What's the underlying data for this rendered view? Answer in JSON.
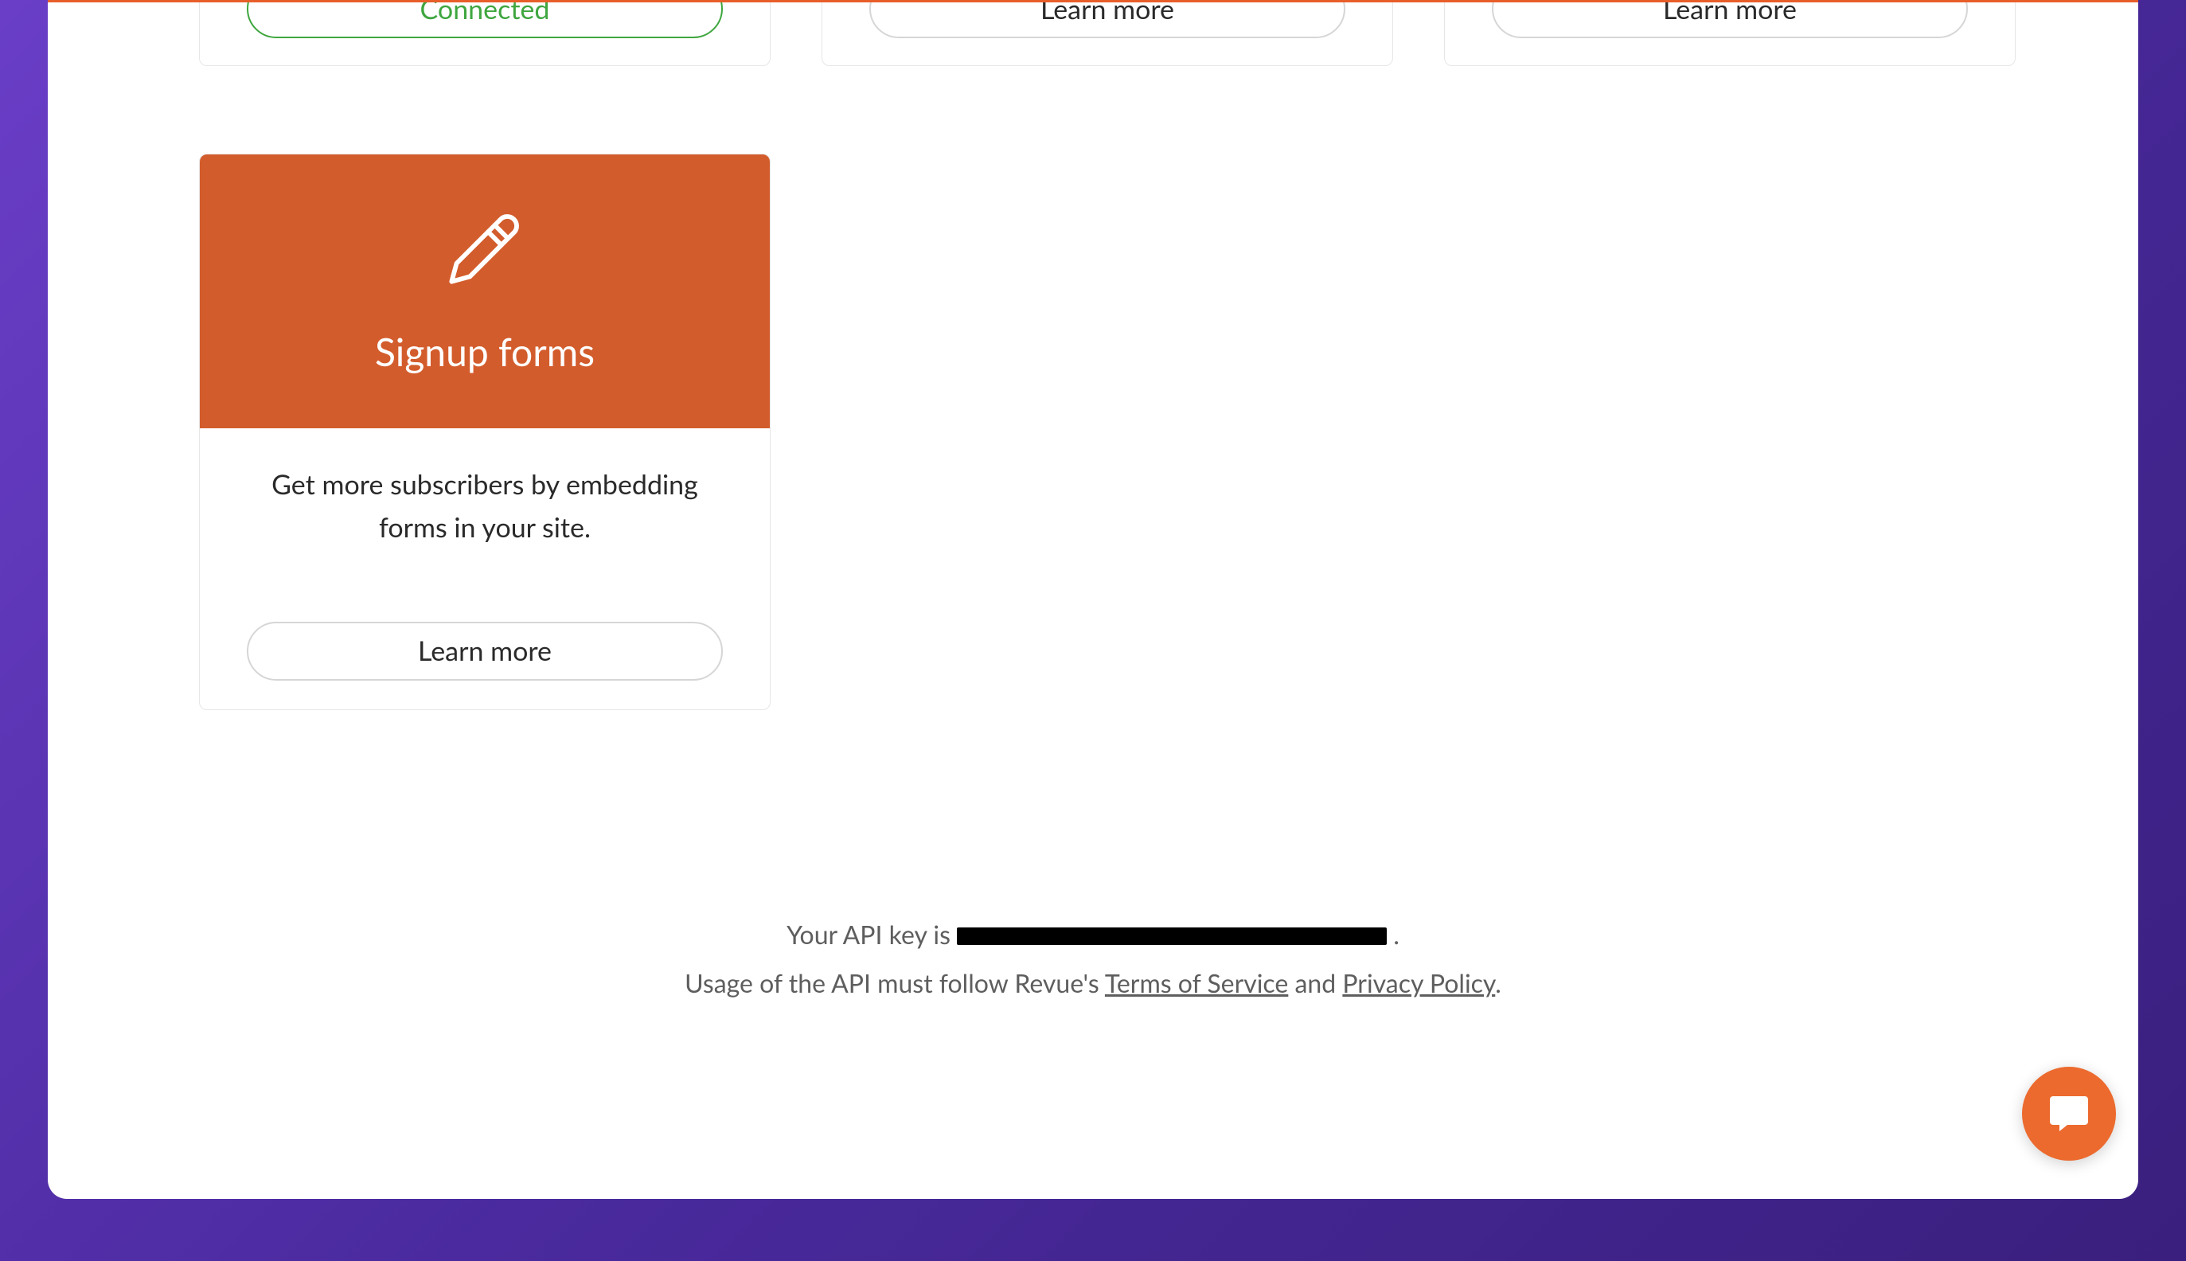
{
  "top_row": {
    "card1_button": "Connected",
    "card2_button": "Learn more",
    "card3_button": "Learn more"
  },
  "signup_card": {
    "title": "Signup forms",
    "description": "Get more subscribers by embedding forms in your site.",
    "button": "Learn more"
  },
  "footer": {
    "api_key_prefix": "Your API key is ",
    "api_key_suffix": " .",
    "usage_prefix": "Usage of the API must follow Revue's ",
    "terms_label": "Terms of Service",
    "and": " and ",
    "privacy_label": "Privacy Policy",
    "period": "."
  }
}
